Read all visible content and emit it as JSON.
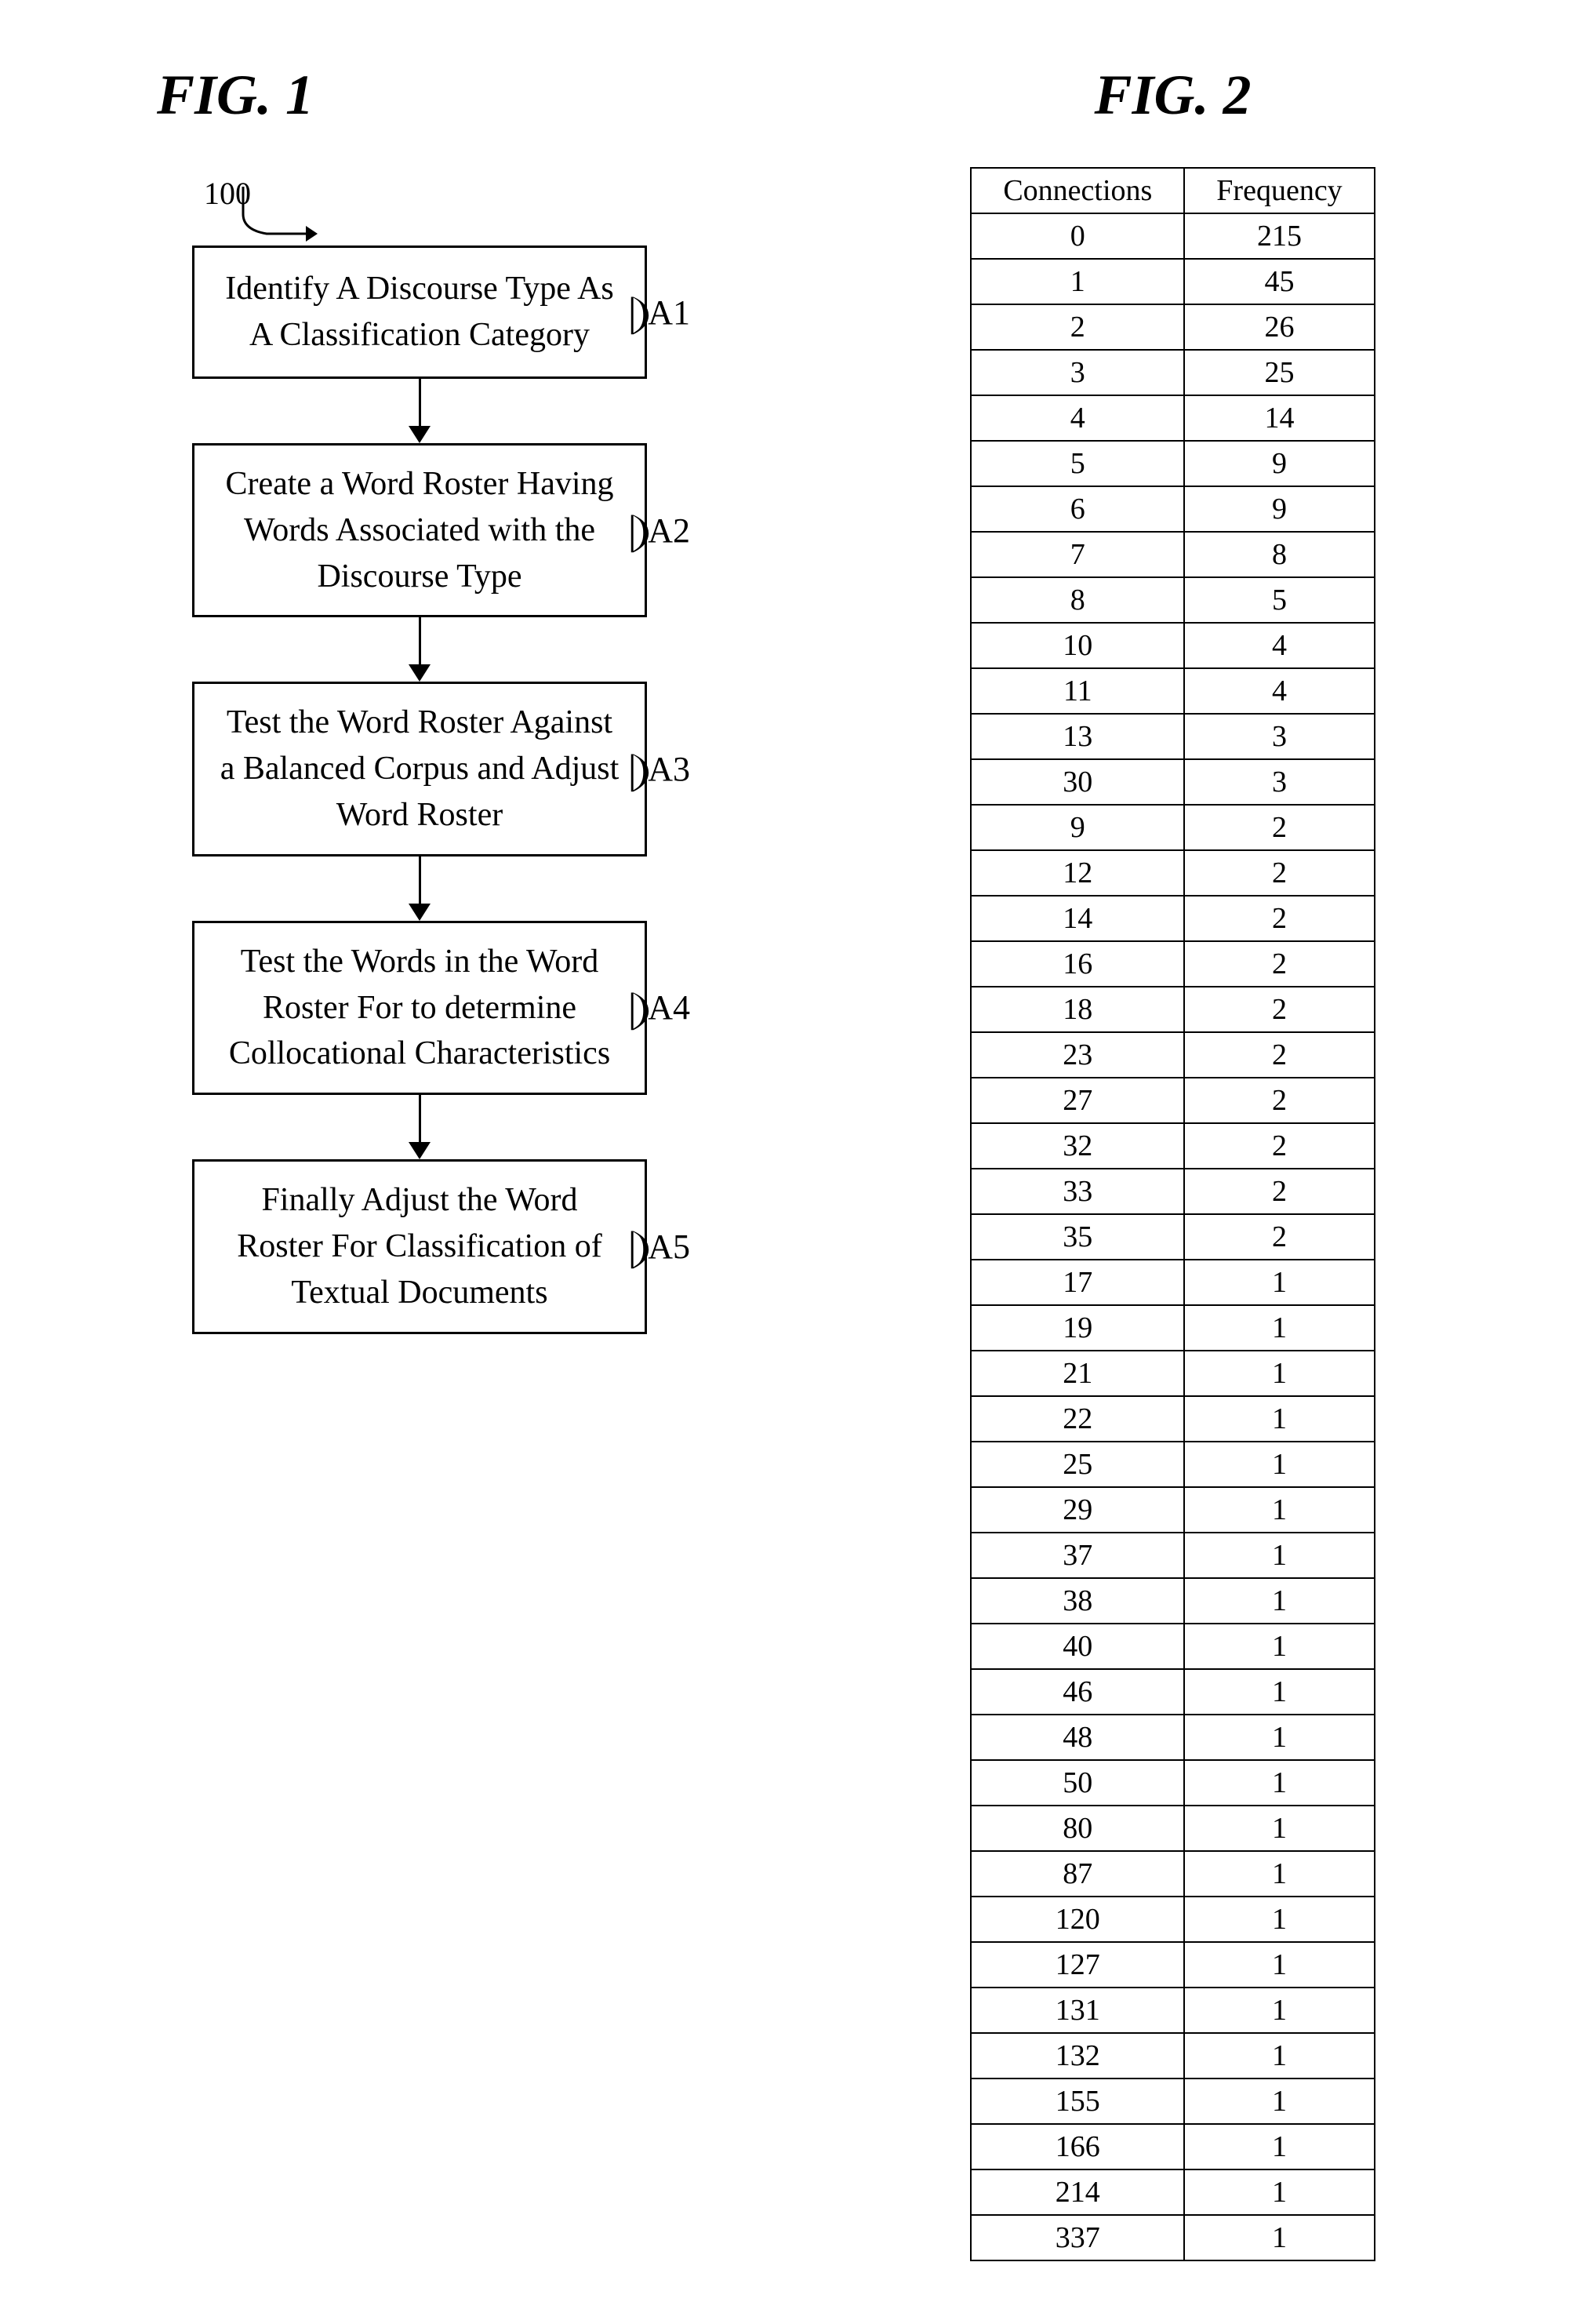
{
  "fig1": {
    "title": "FIG. 1",
    "ref_number": "100",
    "steps": [
      {
        "id": "A1",
        "label": "A1",
        "text": "Identify A Discourse Type As A Classification Category"
      },
      {
        "id": "A2",
        "label": "A2",
        "text": "Create a Word Roster Having Words Associated with the Discourse Type"
      },
      {
        "id": "A3",
        "label": "A3",
        "text": "Test the Word Roster Against a Balanced Corpus and Adjust Word Roster"
      },
      {
        "id": "A4",
        "label": "A4",
        "text": "Test the Words in the Word Roster For to determine Collocational Characteristics"
      },
      {
        "id": "A5",
        "label": "A5",
        "text": "Finally Adjust the Word Roster For Classification of Textual Documents"
      }
    ]
  },
  "fig2": {
    "title": "FIG. 2",
    "headers": [
      "Connections",
      "Frequency"
    ],
    "rows": [
      [
        "0",
        "215"
      ],
      [
        "1",
        "45"
      ],
      [
        "2",
        "26"
      ],
      [
        "3",
        "25"
      ],
      [
        "4",
        "14"
      ],
      [
        "5",
        "9"
      ],
      [
        "6",
        "9"
      ],
      [
        "7",
        "8"
      ],
      [
        "8",
        "5"
      ],
      [
        "10",
        "4"
      ],
      [
        "11",
        "4"
      ],
      [
        "13",
        "3"
      ],
      [
        "30",
        "3"
      ],
      [
        "9",
        "2"
      ],
      [
        "12",
        "2"
      ],
      [
        "14",
        "2"
      ],
      [
        "16",
        "2"
      ],
      [
        "18",
        "2"
      ],
      [
        "23",
        "2"
      ],
      [
        "27",
        "2"
      ],
      [
        "32",
        "2"
      ],
      [
        "33",
        "2"
      ],
      [
        "35",
        "2"
      ],
      [
        "17",
        "1"
      ],
      [
        "19",
        "1"
      ],
      [
        "21",
        "1"
      ],
      [
        "22",
        "1"
      ],
      [
        "25",
        "1"
      ],
      [
        "29",
        "1"
      ],
      [
        "37",
        "1"
      ],
      [
        "38",
        "1"
      ],
      [
        "40",
        "1"
      ],
      [
        "46",
        "1"
      ],
      [
        "48",
        "1"
      ],
      [
        "50",
        "1"
      ],
      [
        "80",
        "1"
      ],
      [
        "87",
        "1"
      ],
      [
        "120",
        "1"
      ],
      [
        "127",
        "1"
      ],
      [
        "131",
        "1"
      ],
      [
        "132",
        "1"
      ],
      [
        "155",
        "1"
      ],
      [
        "166",
        "1"
      ],
      [
        "214",
        "1"
      ],
      [
        "337",
        "1"
      ]
    ]
  }
}
